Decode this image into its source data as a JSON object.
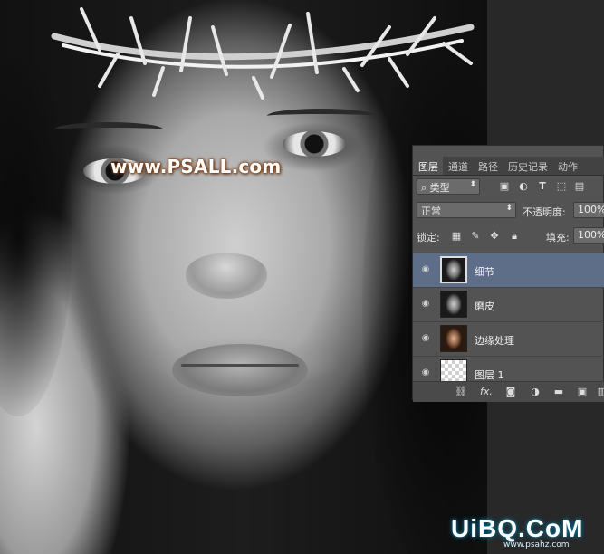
{
  "watermark": "www.PSALL.com",
  "panel": {
    "tabs": [
      "图层",
      "通道",
      "路径",
      "历史记录",
      "动作"
    ],
    "filter": {
      "icon": "search-icon",
      "label": "类型"
    },
    "blend_mode": "正常",
    "opacity_label": "不透明度:",
    "opacity_value": "100%",
    "lock_label": "锁定:",
    "fill_label": "填充:",
    "fill_value": "100%",
    "layers": [
      {
        "name": "细节",
        "selected": true,
        "thumb": "gray-selected"
      },
      {
        "name": "磨皮",
        "selected": false,
        "thumb": "gray"
      },
      {
        "name": "边缘处理",
        "selected": false,
        "thumb": "color"
      },
      {
        "name": "图层 1",
        "selected": false,
        "thumb": "transparent"
      }
    ],
    "bottom_icons": [
      "link-icon",
      "fx-icon",
      "mask-icon",
      "adjustment-icon",
      "folder-icon",
      "new-layer-icon",
      "trash-icon"
    ],
    "fx_label": "fx."
  },
  "logo": {
    "text": "UiBQ.CoM",
    "sub": "www.psahz.com"
  },
  "colors": {
    "selected_layer": "#5e6e88",
    "panel_bg": "#535353"
  }
}
